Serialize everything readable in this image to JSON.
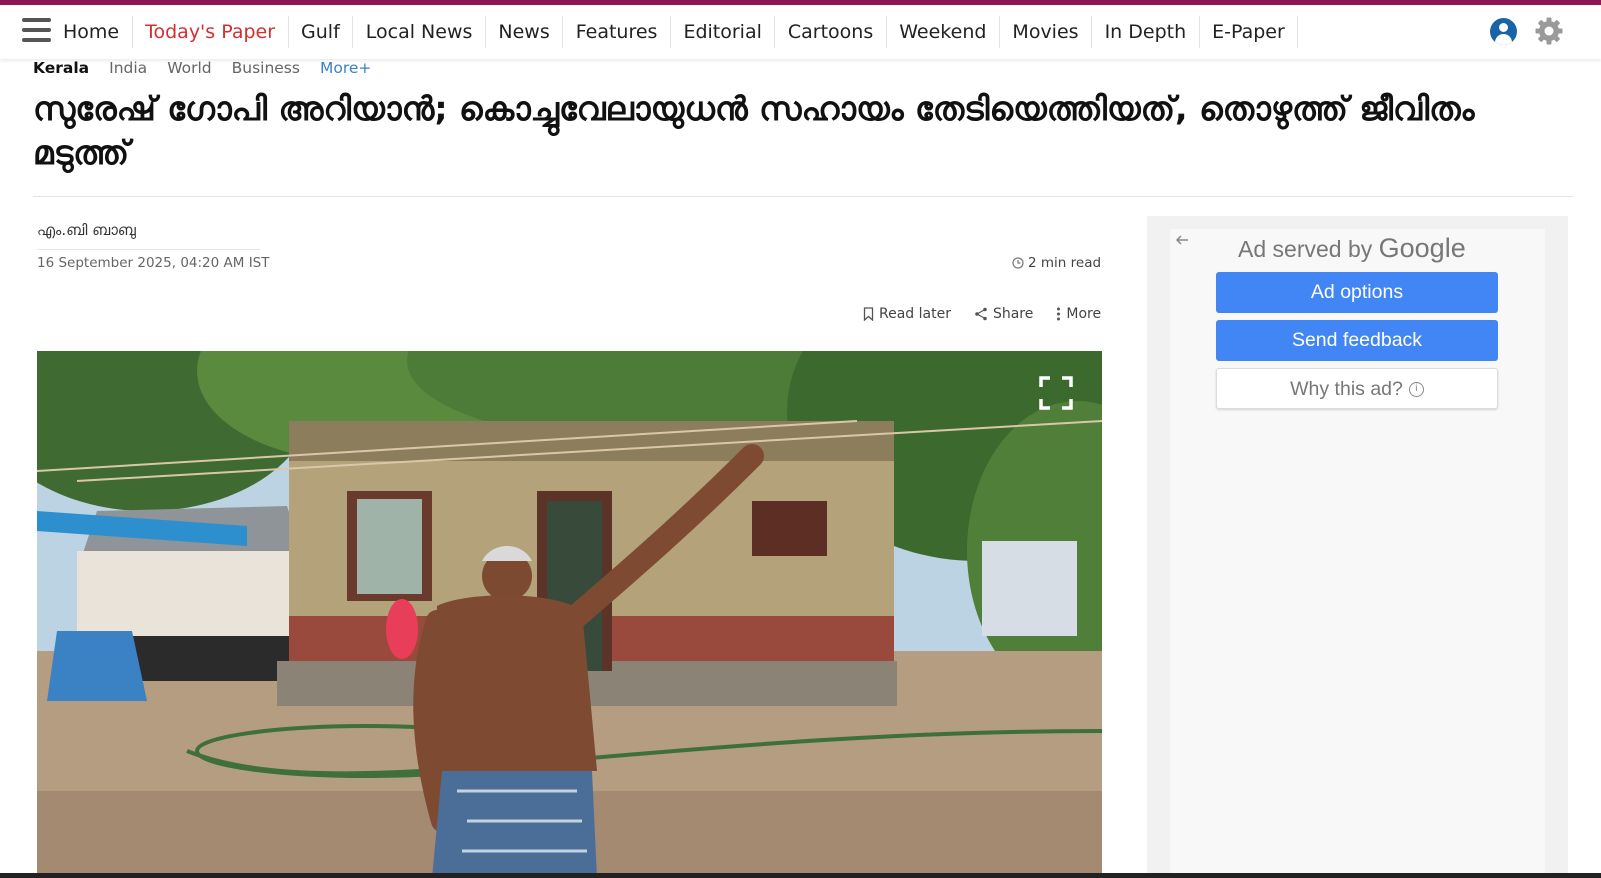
{
  "nav": {
    "items": [
      "Home",
      "Today's Paper",
      "Gulf",
      "Local News",
      "News",
      "Features",
      "Editorial",
      "Cartoons",
      "Weekend",
      "Movies",
      "In Depth",
      "E-Paper"
    ],
    "active_index": 1
  },
  "subnav": {
    "current": "Kerala",
    "items": [
      "India",
      "World",
      "Business"
    ],
    "more": "More+"
  },
  "article": {
    "headline": "സുരേഷ് ഗോപി അറിയാൻ; കൊച്ചുവേലായുധൻ സഹായം തേടിയെത്തിയത്, തൊഴുത്ത് ജീവിതം മടുത്ത്",
    "author": "എം.ബി ബാബു",
    "date": "16 September 2025, 04:20 AM IST",
    "read_time": "2 min read",
    "actions": {
      "read_later": "Read later",
      "share": "Share",
      "more": "More"
    }
  },
  "ad": {
    "served_by": "Ad served by",
    "brand": "Google",
    "options": "Ad options",
    "feedback": "Send feedback",
    "why": "Why this ad?"
  },
  "colors": {
    "brand_strip": "#8e1652",
    "active_link": "#d32f2f",
    "more_link": "#3b82c6",
    "ad_button": "#4285f4"
  }
}
